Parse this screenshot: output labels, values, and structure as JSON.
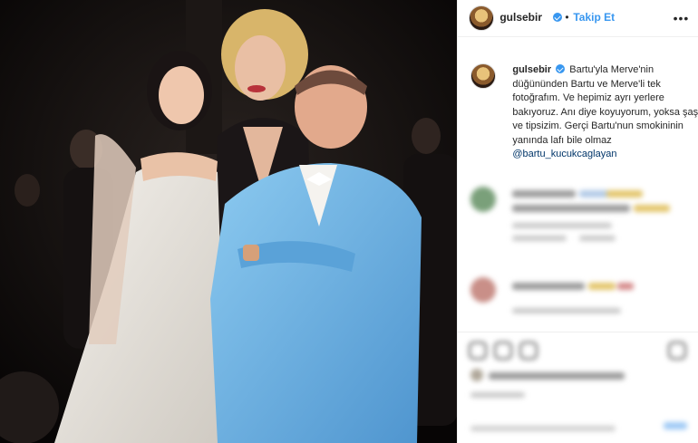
{
  "post": {
    "username": "gulsebir",
    "separator": "•",
    "follow_label": "Takip Et",
    "more_label": "•••",
    "caption": {
      "username": "gulsebir",
      "text": "Bartu'yla Merve'nin düğününden Bartu ve Merve'li tek fotoğrafım. Ve hepimiz ayrı yerlere bakıyoruz. Anı diye koyuyorum, yoksa şaşı ve tipsizim. Gerçi Bartu'nun smokininin yanında lafı bile olmaz",
      "mention": "@bartu_kucukcaglayan"
    }
  },
  "colors": {
    "accent": "#3897f0",
    "mention": "#003569",
    "photo_bg": "#0b0909",
    "suit": "#6fb3e4"
  }
}
